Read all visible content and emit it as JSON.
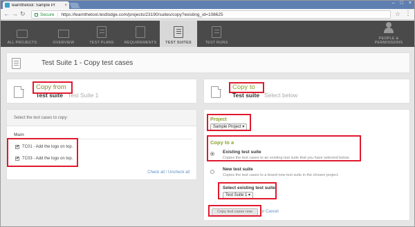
{
  "browser": {
    "tab_title": "learnthetool: Sample Pr",
    "tab_close": "×",
    "secure_label": "Secure",
    "url": "https://learnthetool.testlodge.com/projects/23190/suites/copy?existing_id=108625",
    "window_controls": [
      "–",
      "□",
      "×"
    ]
  },
  "nav": {
    "items": [
      {
        "label": "ALL PROJECTS",
        "icon": "folder-icon"
      },
      {
        "label": "OVERVIEW",
        "icon": "monitor-icon"
      },
      {
        "label": "TEST PLANS",
        "icon": "document-icon"
      },
      {
        "label": "REQUIREMENTS",
        "icon": "document-icon"
      },
      {
        "label": "TEST SUITES",
        "icon": "document-icon",
        "active": true
      },
      {
        "label": "TEST RUNS",
        "icon": "document-icon"
      },
      {
        "label": "PEOPLE &\nPERMISSIONS",
        "icon": "person-icon"
      }
    ]
  },
  "page": {
    "title": "Test Suite 1 - Copy test cases"
  },
  "copy_from": {
    "label": "Copy from",
    "sub_strong": "Test suite",
    "sub_light": "Test Suite 1",
    "instructions": "Select the test cases to copy:",
    "group": "Main",
    "cases": [
      {
        "label": "TC01 - Add the logo on top.",
        "checked": true,
        "mark": "✔"
      },
      {
        "label": "TC03 - Add the logo on top.",
        "checked": true,
        "mark": "✔"
      }
    ],
    "check_all": "Check all",
    "separator": "/",
    "uncheck_all": "Uncheck all"
  },
  "copy_to": {
    "label": "Copy to",
    "sub_strong": "Test suite",
    "sub_light": "Select below",
    "project_label": "Project",
    "project_value": "Sample Project ▾",
    "copy_to_a": "Copy to a",
    "options": [
      {
        "title": "Existing test suite",
        "desc": "Copies the test cases to an existing test suite that you have selected below.",
        "checked": true
      },
      {
        "title": "New test suite",
        "desc": "Copies the test cases to a brand new test suite in the chosen project.",
        "checked": false
      }
    ],
    "select_existing_label": "Select existing test suite",
    "select_existing_value": "Test Suite 1 ▾",
    "copy_button": "Copy test cases now",
    "or_text": "or",
    "cancel": "Cancel"
  },
  "colors": {
    "annotation_red": "#e0182d",
    "label_green": "#8aa32a",
    "nav_dark": "#4a4a4a",
    "link_blue": "#5b8fc7"
  }
}
